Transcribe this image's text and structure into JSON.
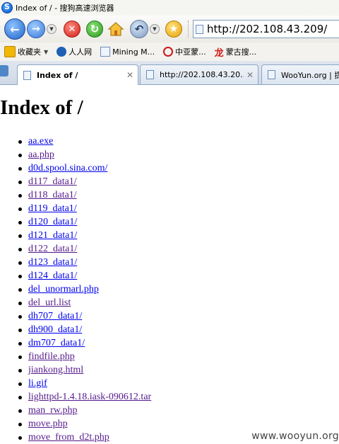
{
  "window": {
    "title": "Index of / - 搜狗高速浏览器"
  },
  "toolbar": {
    "address": "http://202.108.43.209/"
  },
  "favorites": {
    "folder_label": "收藏夹",
    "items": [
      {
        "label": "人人网",
        "icon": "renren-icon"
      },
      {
        "label": "Mining M...",
        "icon": "page-icon"
      },
      {
        "label": "中亚蒙...",
        "icon": "ie-icon"
      },
      {
        "label": "蒙古搜...",
        "icon": "dragon-icon"
      }
    ]
  },
  "tabs": [
    {
      "label": "Index of /",
      "active": true
    },
    {
      "label": "http://202.108.43.20...",
      "active": false
    },
    {
      "label": "WooYun.org | 提",
      "active": false
    }
  ],
  "page": {
    "heading": "Index of /",
    "links": [
      {
        "text": "aa.exe",
        "visited": false
      },
      {
        "text": "aa.php",
        "visited": true
      },
      {
        "text": "d0d.spool.sina.com/",
        "visited": false
      },
      {
        "text": "d117_data1/",
        "visited": true
      },
      {
        "text": "d118_data1/",
        "visited": true
      },
      {
        "text": "d119_data1/",
        "visited": false
      },
      {
        "text": "d120_data1/",
        "visited": false
      },
      {
        "text": "d121_data1/",
        "visited": false
      },
      {
        "text": "d122_data1/",
        "visited": true
      },
      {
        "text": "d123_data1/",
        "visited": false
      },
      {
        "text": "d124_data1/",
        "visited": false
      },
      {
        "text": "del_unormarl.php",
        "visited": false
      },
      {
        "text": "del_url.list",
        "visited": true
      },
      {
        "text": "dh707_data1/",
        "visited": false
      },
      {
        "text": "dh900_data1/",
        "visited": false
      },
      {
        "text": "dm707_data1/",
        "visited": false
      },
      {
        "text": "findfile.php",
        "visited": true
      },
      {
        "text": "jiankong.html",
        "visited": true
      },
      {
        "text": "li.gif",
        "visited": false
      },
      {
        "text": "lighttpd-1.4.18.iask-090612.tar",
        "visited": true
      },
      {
        "text": "man_rw.php",
        "visited": true
      },
      {
        "text": "move.php",
        "visited": true
      },
      {
        "text": "move_from_d2t.php",
        "visited": true
      }
    ]
  },
  "watermark": "www.wooyun.org"
}
